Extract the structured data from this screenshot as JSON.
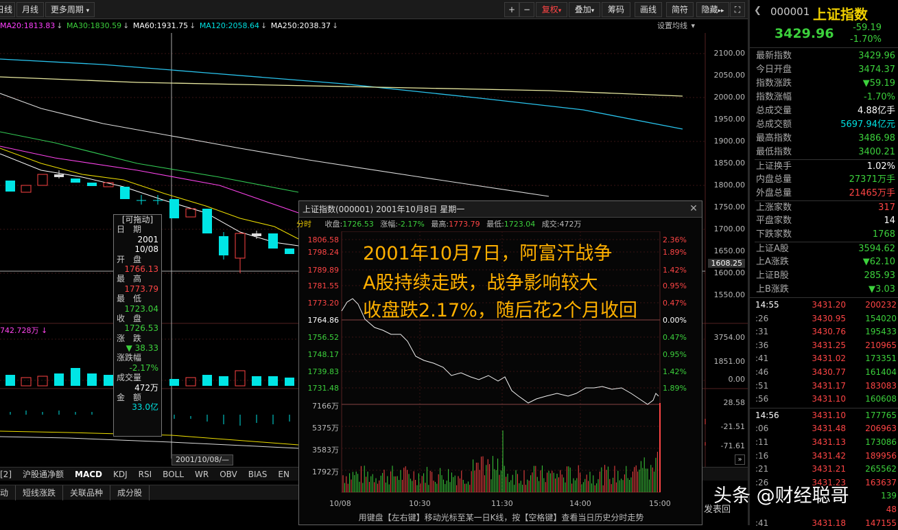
{
  "toolbar": {
    "left": [
      "日线",
      "月线",
      "更多周期"
    ],
    "plus": "+",
    "minus": "−",
    "fuquan": "复权",
    "diejia": "叠加",
    "chouma": "筹码",
    "huaxian": "画线",
    "jiancao": "简符",
    "yincang": "隐藏"
  },
  "ma": {
    "ma20": "MA20:1813.83",
    "ma30": "MA30:1830.59",
    "ma60": "MA60:1931.75",
    "ma120": "MA120:2058.64",
    "ma250": "MA250:2038.37",
    "settings": "设置均线"
  },
  "price_axis": [
    "2100.00",
    "2050.00",
    "2000.00",
    "1950.00",
    "1900.00",
    "1850.00",
    "1800.00",
    "1750.00",
    "1700.00",
    "1650.00",
    "1608.25",
    "1600.00",
    "1550.00"
  ],
  "volume_axis": [
    "3754.00",
    "1851.00",
    "0.00"
  ],
  "macd_axis": [
    "28.58",
    "-21.51",
    "-71.61"
  ],
  "volume_label": "742.728万",
  "date_marker": "2001/10/08/—",
  "drag_box": {
    "title": "[可拖动]",
    "date_label": "日　期",
    "year": "2001",
    "md": "10/08",
    "open_label": "开　盘",
    "open": "1766.13",
    "high_label": "最　高",
    "high": "1773.79",
    "low_label": "最　低",
    "low": "1723.04",
    "close_label": "收　盘",
    "close": "1726.53",
    "change_label": "涨　跌",
    "change": "▼ 38.33",
    "pct_label": "涨跌幅",
    "pct": "-2.17%",
    "vol_label": "成交量",
    "vol": "472万",
    "amt_label": "金　额",
    "amt": "33.0亿"
  },
  "bottom_tabs": [
    "[2]",
    "沪股通净额",
    "MACD",
    "KDJ",
    "RSI",
    "BOLL",
    "WR",
    "OBV",
    "BIAS",
    "EN"
  ],
  "bottom_tabs2": [
    "动",
    "短线涨跌",
    "关联品种",
    "成分股"
  ],
  "popup": {
    "title": "上证指数(000001) 2001年10月8日 星期一",
    "tag": "分时",
    "close_label": "收盘:",
    "close": "1726.53",
    "pct_label": "涨幅:",
    "pct": "-2.17%",
    "high_label": "最高:",
    "high": "1773.79",
    "low_label": "最低:",
    "low": "1723.04",
    "vol_label": "成交:",
    "vol": "472万",
    "left_axis": [
      "1806.58",
      "1798.24",
      "1789.89",
      "1781.55",
      "1773.20",
      "1764.86",
      "1756.52",
      "1748.17",
      "1739.83",
      "1731.48"
    ],
    "right_axis": [
      "2.36%",
      "1.89%",
      "1.42%",
      "0.95%",
      "0.47%",
      "0.00%",
      "0.47%",
      "0.95%",
      "1.42%",
      "1.89%"
    ],
    "vol_axis": [
      "7166万",
      "5375万",
      "3583万",
      "1792万"
    ],
    "time_axis": [
      "10/08",
      "10:30",
      "11:30",
      "14:00",
      "15:00"
    ],
    "overlay": [
      "2001年10月7日，阿富汗战争",
      "A股持续走跌，战争影响较大",
      "收盘跌2.17%，随后花2个月收回"
    ],
    "footer": "用键盘【左右键】移动光标至某一日K线，按【空格键】查看当日历史分时走势"
  },
  "right_panel": {
    "code": "000001",
    "name": "上证指数",
    "price": "3429.96",
    "change": "-59.19",
    "pct": "-1.70%",
    "stats": [
      {
        "label": "最新指数",
        "value": "3429.96",
        "color": "g"
      },
      {
        "label": "今日开盘",
        "value": "3474.37",
        "color": "g"
      },
      {
        "label": "指数涨跌",
        "value": "▼59.19",
        "color": "g"
      },
      {
        "label": "指数涨幅",
        "value": "-1.70%",
        "color": "g"
      },
      {
        "label": "总成交量",
        "value": "4.88亿手",
        "color": "w"
      },
      {
        "label": "总成交额",
        "value": "5697.94亿元",
        "color": "c"
      },
      {
        "label": "最高指数",
        "value": "3486.98",
        "color": "g"
      },
      {
        "label": "最低指数",
        "value": "3400.21",
        "color": "g"
      },
      {
        "label": "上证换手",
        "value": "1.02%",
        "color": "w"
      },
      {
        "label": "内盘总量",
        "value": "27371万手",
        "color": "g"
      },
      {
        "label": "外盘总量",
        "value": "21465万手",
        "color": "rd"
      },
      {
        "label": "上涨家数",
        "value": "317",
        "color": "rd"
      },
      {
        "label": "平盘家数",
        "value": "14",
        "color": "w"
      },
      {
        "label": "下跌家数",
        "value": "1768",
        "color": "g"
      },
      {
        "label": "上证A股",
        "value": "3594.62",
        "color": "g"
      },
      {
        "label": "上A涨跌",
        "value": "▼62.10",
        "color": "g"
      },
      {
        "label": "上证B股",
        "value": "285.93",
        "color": "g"
      },
      {
        "label": "上B涨跌",
        "value": "▼3.03",
        "color": "g"
      }
    ],
    "ticks": [
      {
        "t": "14:55",
        "p": "3431.20",
        "q": "200232",
        "c": "rd"
      },
      {
        "t": ":26",
        "p": "3430.95",
        "q": "154020",
        "c": "g"
      },
      {
        "t": ":31",
        "p": "3430.76",
        "q": "195433",
        "c": "g"
      },
      {
        "t": ":36",
        "p": "3431.25",
        "q": "210965",
        "c": "rd"
      },
      {
        "t": ":41",
        "p": "3431.02",
        "q": "173351",
        "c": "g"
      },
      {
        "t": ":46",
        "p": "3430.77",
        "q": "161404",
        "c": "g"
      },
      {
        "t": ":51",
        "p": "3431.17",
        "q": "183083",
        "c": "rd"
      },
      {
        "t": ":56",
        "p": "3431.10",
        "q": "160608",
        "c": "g"
      },
      {
        "t": "14:56",
        "p": "3431.10",
        "q": "177765",
        "c": "g"
      },
      {
        "t": ":06",
        "p": "3431.48",
        "q": "206963",
        "c": "rd"
      },
      {
        "t": ":11",
        "p": "3431.13",
        "q": "173086",
        "c": "g"
      },
      {
        "t": ":16",
        "p": "3431.42",
        "q": "189956",
        "c": "rd"
      },
      {
        "t": ":21",
        "p": "3431.21",
        "q": "265562",
        "c": "g"
      },
      {
        "t": ":26",
        "p": "3431.23",
        "q": "163637",
        "c": "rd"
      },
      {
        "t": "",
        "p": "",
        "q": "139",
        "c": "g"
      },
      {
        "t": "",
        "p": "",
        "q": "48",
        "c": "rd"
      },
      {
        "t": ":41",
        "p": "3431.18",
        "q": "147155",
        "c": "rd"
      }
    ]
  },
  "misc": {
    "fasong": "发表回"
  },
  "watermark": "头条 @财经聪哥"
}
